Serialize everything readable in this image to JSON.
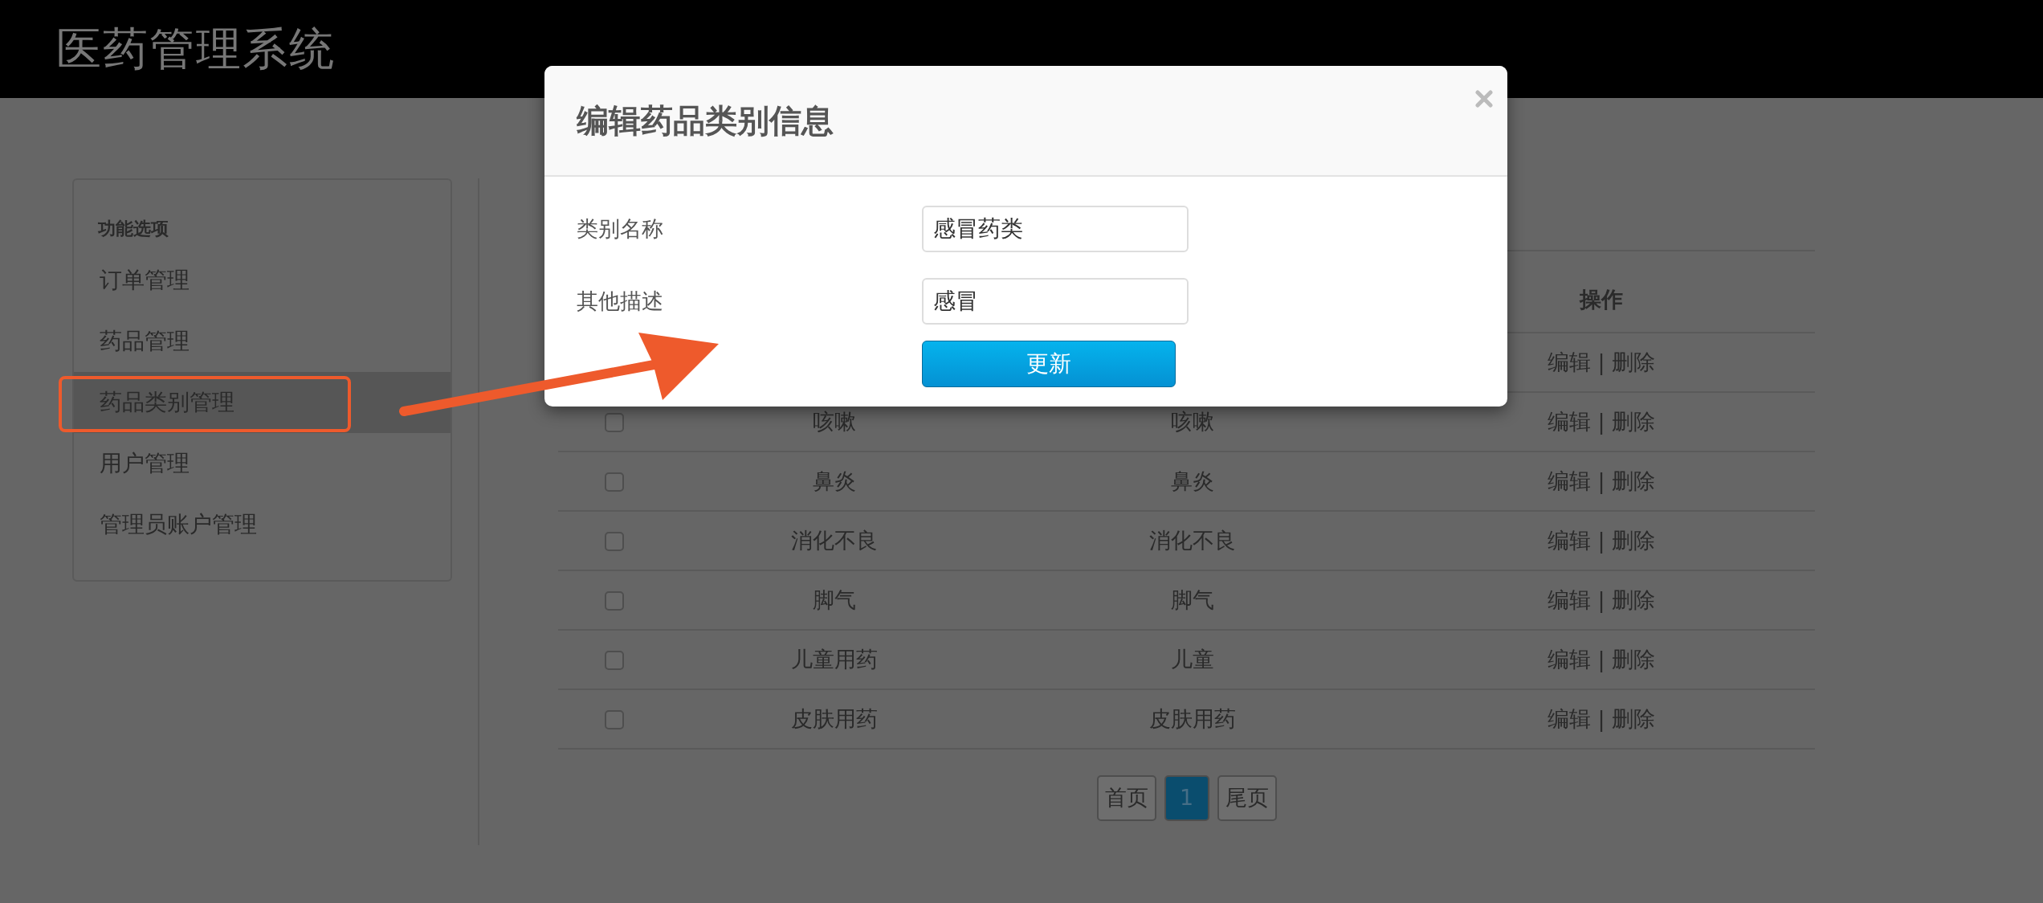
{
  "header": {
    "title": "医药管理系统"
  },
  "sidebar": {
    "heading": "功能选项",
    "items": [
      {
        "label": "订单管理",
        "selected": false
      },
      {
        "label": "药品管理",
        "selected": false
      },
      {
        "label": "药品类别管理",
        "selected": true,
        "highlighted": true
      },
      {
        "label": "用户管理",
        "selected": false
      },
      {
        "label": "管理员账户管理",
        "selected": false
      }
    ]
  },
  "table": {
    "columns": [
      {},
      {},
      {},
      {
        "label": "操作"
      }
    ],
    "rows": [
      {
        "actions": [
          "编辑",
          "删除"
        ],
        "separator": "|"
      },
      {
        "checked": false,
        "cells": [
          "咳嗽",
          "咳嗽"
        ],
        "actions": [
          "编辑",
          "删除"
        ],
        "separator": "|"
      },
      {
        "checked": false,
        "cells": [
          "鼻炎",
          "鼻炎"
        ],
        "actions": [
          "编辑",
          "删除"
        ],
        "separator": "|"
      },
      {
        "checked": false,
        "cells": [
          "消化不良",
          "消化不良"
        ],
        "actions": [
          "编辑",
          "删除"
        ],
        "separator": "|"
      },
      {
        "checked": false,
        "cells": [
          "脚气",
          "脚气"
        ],
        "actions": [
          "编辑",
          "删除"
        ],
        "separator": "|"
      },
      {
        "checked": false,
        "cells": [
          "儿童用药",
          "儿童"
        ],
        "actions": [
          "编辑",
          "删除"
        ],
        "separator": "|"
      },
      {
        "checked": false,
        "cells": [
          "皮肤用药",
          "皮肤用药"
        ],
        "actions": [
          "编辑",
          "删除"
        ],
        "separator": "|"
      }
    ]
  },
  "pagination": [
    {
      "label": "首页",
      "selected": false
    },
    {
      "label": "1",
      "selected": true
    },
    {
      "label": "尾页",
      "selected": false
    }
  ],
  "modal": {
    "title": "编辑药品类别信息",
    "fields": [
      {
        "label": "类别名称",
        "value": "感冒药类"
      },
      {
        "label": "其他描述",
        "value": "感冒"
      }
    ],
    "button": "更新"
  }
}
